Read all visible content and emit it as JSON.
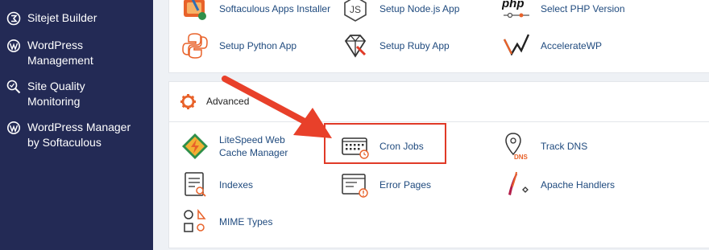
{
  "sidebar": {
    "items": [
      {
        "label": "Sitejet Builder",
        "icon": "sitejet-icon"
      },
      {
        "label": "WordPress Management",
        "icon": "wordpress-icon"
      },
      {
        "label": "Site Quality Monitoring",
        "icon": "site-quality-icon"
      },
      {
        "label": "WordPress Manager by Softaculous",
        "icon": "wordpress-icon"
      }
    ]
  },
  "software": {
    "apps": [
      {
        "label": "Softaculous Apps Installer",
        "icon": "softaculous-icon"
      },
      {
        "label": "Setup Node.js App",
        "icon": "nodejs-icon"
      },
      {
        "label": "Select PHP Version",
        "icon": "php-icon"
      },
      {
        "label": "Setup Python App",
        "icon": "python-icon"
      },
      {
        "label": "Setup Ruby App",
        "icon": "ruby-icon"
      },
      {
        "label": "AccelerateWP",
        "icon": "acceleratewp-icon"
      }
    ]
  },
  "advanced": {
    "title": "Advanced",
    "icon": "gear-icon",
    "apps": [
      {
        "label": "LiteSpeed Web Cache Manager",
        "icon": "litespeed-icon"
      },
      {
        "label": "Cron Jobs",
        "icon": "cron-jobs-icon"
      },
      {
        "label": "Track DNS",
        "icon": "track-dns-icon"
      },
      {
        "label": "Indexes",
        "icon": "indexes-icon"
      },
      {
        "label": "Error Pages",
        "icon": "error-pages-icon"
      },
      {
        "label": "Apache Handlers",
        "icon": "apache-handlers-icon"
      },
      {
        "label": "MIME Types",
        "icon": "mime-types-icon"
      }
    ]
  },
  "colors": {
    "sidebar_bg": "#232a55",
    "link_text": "#1f4a7e",
    "highlight": "#e03a27",
    "accent_orange": "#e8622a"
  }
}
